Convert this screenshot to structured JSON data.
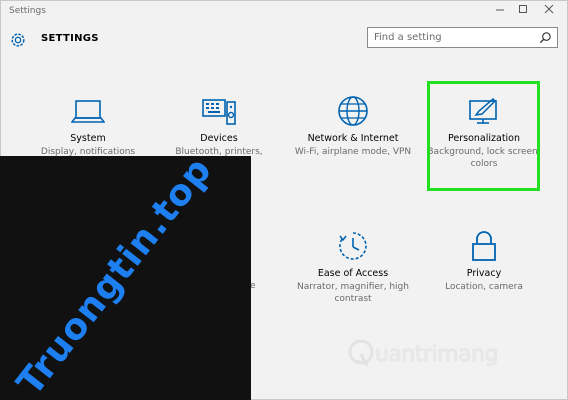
{
  "window": {
    "title": "Settings"
  },
  "header": {
    "title": "SETTINGS"
  },
  "search": {
    "placeholder": "Find a setting"
  },
  "tiles": [
    {
      "label": "System",
      "desc": "Display, notifications"
    },
    {
      "label": "Devices",
      "desc": "Bluetooth, printers,"
    },
    {
      "label": "Network & Internet",
      "desc": "Wi-Fi, airplane mode, VPN"
    },
    {
      "label": "Personalization",
      "desc": "Background, lock screen, colors"
    },
    {
      "label": "Ease of Access",
      "desc": "Narrator, magnifier, high contrast"
    },
    {
      "label": "Privacy",
      "desc": "Location, camera"
    }
  ],
  "partial_hidden": {
    "label_tail": "e",
    "desc_tail": "ate"
  },
  "watermarks": {
    "overlay_text": "Truongtin.top",
    "logo_text": "uantrimang"
  },
  "colors": {
    "accent": "#0063b1",
    "highlight": "#20e020",
    "overlay": "#111111",
    "watermark": "#1d7ff0"
  }
}
